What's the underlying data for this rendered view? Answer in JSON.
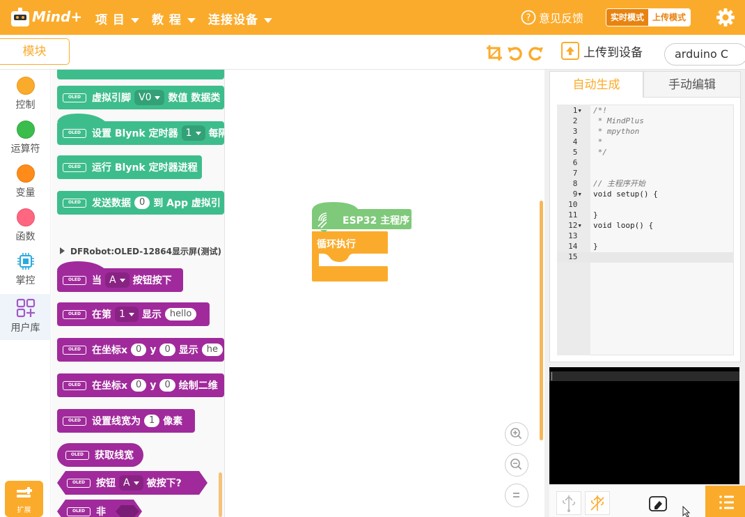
{
  "topbar": {
    "logo_text": "Mind+",
    "menu": [
      "项 目",
      "教 程",
      "连接设备"
    ],
    "feedback": "意见反馈",
    "mode_realtime": "实时模式",
    "mode_upload": "上传模式"
  },
  "toolbar": {
    "modules_tab": "模块",
    "upload_label": "上传到设备",
    "language": "arduino C"
  },
  "categories": [
    {
      "label": "控制",
      "color": "#fbab2b"
    },
    {
      "label": "运算符",
      "color": "#3bbd4d"
    },
    {
      "label": "变量",
      "color": "#ff8c1a"
    },
    {
      "label": "函数",
      "color": "#ff6680"
    },
    {
      "label": "掌控"
    },
    {
      "label": "用户库"
    }
  ],
  "extensions_label": "扩展",
  "palette": {
    "blynk_blocks": {
      "vpin_prefix": "虚拟引脚",
      "vpin_value": "V0",
      "vpin_suffix": "数值 数据类",
      "timer_prefix": "设置 Blynk 定时器",
      "timer_value": "1",
      "timer_suffix": "每隔",
      "run_timer": "运行 Blynk 定时器进程",
      "send_prefix": "发送数据",
      "send_value": "0",
      "send_suffix": "到 App 虚拟引"
    },
    "section_title": "DFRobot:OLED-12864显示屏(测试)",
    "oled_blocks": {
      "when_prefix": "当",
      "when_value": "A",
      "when_suffix": "按钮按下",
      "row_prefix": "在第",
      "row_value": "1",
      "row_mid": "显示",
      "row_text": "hello",
      "coord_prefix": "在坐标x",
      "coord_x": "0",
      "coord_y_label": "y",
      "coord_y": "0",
      "coord_show": "显示",
      "coord_show_text": "he",
      "coord2_prefix": "在坐标x",
      "coord2_x": "0",
      "coord2_y_label": "y",
      "coord2_y": "0",
      "coord2_draw": "绘制二维",
      "linewidth_prefix": "设置线宽为",
      "linewidth_value": "1",
      "linewidth_suffix": "像素",
      "get_linewidth": "获取线宽",
      "button_prefix": "按钮",
      "button_value": "A",
      "button_suffix": "被按下?",
      "not_label": "非"
    },
    "oled_badge": "OLED"
  },
  "workspace": {
    "main_block": "ESP32 主程序",
    "loop_block": "循环执行"
  },
  "code_tabs": {
    "auto": "自动生成",
    "manual": "手动编辑"
  },
  "code_lines": [
    "/*!",
    " * MindPlus",
    " * mpython",
    " *",
    " */",
    "",
    "",
    "// 主程序开始",
    "void setup() {",
    "",
    "}",
    "void loop() {",
    "",
    "}",
    ""
  ],
  "colors": {
    "accent": "#fbab2b",
    "blynk_block": "#3ebd8c",
    "oled_block": "#a02a9b",
    "esp32_hat": "#7fc97a",
    "loop_block": "#fbab2b"
  }
}
